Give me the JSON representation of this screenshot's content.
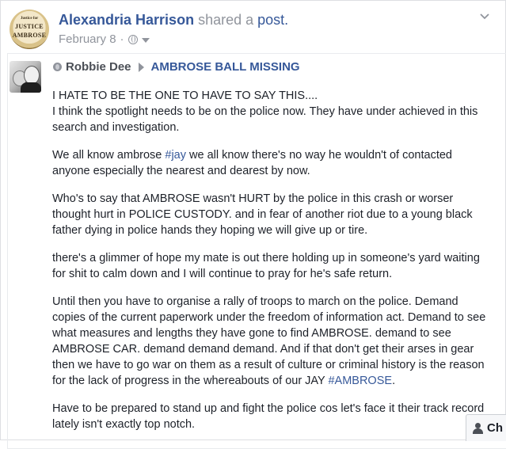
{
  "header": {
    "sharer_name": "Alexandria Harrison",
    "shared_text": "shared a",
    "post_link": "post.",
    "date": "February 8",
    "separator": "·",
    "avatar_text_top": "Justice for",
    "avatar_text_1": "JUSTICE",
    "avatar_text_2": "AMBROSE"
  },
  "shared_post": {
    "author": "Robbie Dee",
    "group": "AMBROSE BALL MISSING",
    "paragraphs": [
      {
        "line1": "I HATE TO BE THE ONE TO HAVE TO SAY THIS....",
        "line2": "I think the spotlight needs to be on the police now. They have under achieved in this search and investigation."
      },
      {
        "before": "We all know ambrose ",
        "hashtag": "#jay",
        "after": " we all know there's no way he wouldn't of contacted anyone especially the nearest and dearest by now."
      },
      {
        "text": "Who's to say that AMBROSE wasn't HURT by the police in this crash or worser thought hurt in POLICE CUSTODY. and in fear of another riot due to a young black father dying in police hands they hoping we will give up or tire."
      },
      {
        "text": "there's a glimmer of hope my mate is out there holding up in someone's yard waiting for shit to calm down and I will continue to pray for he's safe return."
      },
      {
        "before": "Until then you have to organise a rally of troops to march on the police. Demand copies of the current paperwork under the freedom of information act. Demand to see what measures and lengths they have gone to find AMBROSE. demand to see AMBROSE CAR. demand demand demand. And if that don't get their arses in gear then we have to go war on them as a result of culture or criminal history is the reason for the lack of progress in the whereabouts of our JAY ",
        "hashtag": "#AMBROSE",
        "after": "."
      },
      {
        "text": "Have to be prepared to stand up and fight the police cos let's face it their track record lately isn't exactly top notch."
      }
    ]
  },
  "chat": {
    "label": "Ch"
  },
  "icons": {
    "privacy": "globe-icon",
    "audience_caret": "caret-down-icon",
    "options": "chevron-down-icon",
    "group_arrow": "triangle-right-icon",
    "chat": "person-icon"
  },
  "colors": {
    "link": "#365899",
    "meta": "#90949c",
    "text": "#1d2129"
  }
}
